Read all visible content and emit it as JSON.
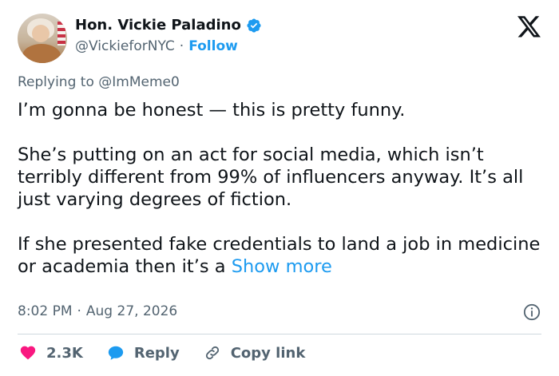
{
  "header": {
    "display_name": "Hon. Vickie Paladino",
    "handle": "@VickieforNYC",
    "separator": "·",
    "follow_label": "Follow"
  },
  "reply": {
    "prefix": "Replying to",
    "mention": "@ImMeme0"
  },
  "tweet": {
    "paragraphs": [
      "I’m gonna be honest — this is pretty funny.",
      "She’s putting on an act for social media, which isn’t terribly different from 99% of influencers anyway. It’s all just varying degrees of fiction.",
      "If she presented fake credentials to land a job in medicine or academia then it’s a"
    ],
    "show_more": "Show more"
  },
  "meta": {
    "time": "8:02 PM",
    "separator": "·",
    "date": "Aug 27, 2026"
  },
  "actions": {
    "likes": "2.3K",
    "reply_label": "Reply",
    "copy_link_label": "Copy link"
  },
  "icons": {
    "verified": "verified-badge-icon",
    "logo": "x-logo-icon",
    "info": "info-icon",
    "like": "heart-icon",
    "reply": "speech-bubble-icon",
    "link": "link-icon"
  },
  "colors": {
    "accent": "#1d9bf0",
    "like": "#f91880",
    "muted": "#536471",
    "text": "#0f1419"
  }
}
